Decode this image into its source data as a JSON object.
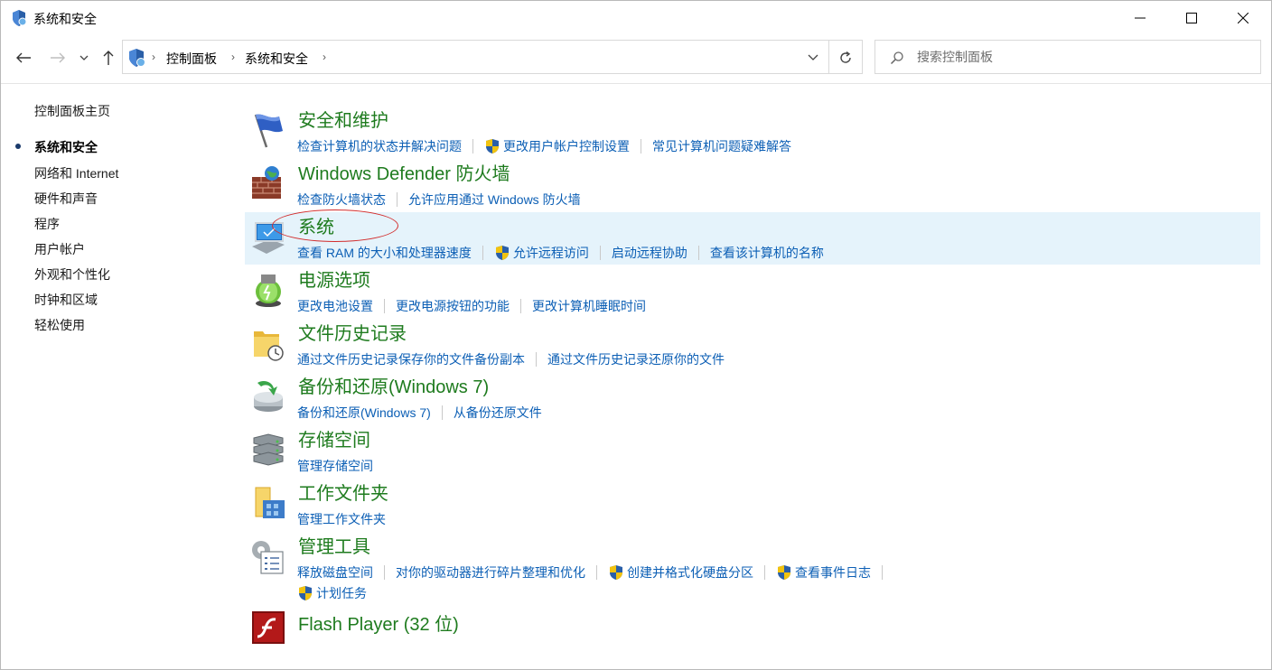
{
  "window": {
    "title": "系统和安全",
    "controls": {
      "minimize": "minimize",
      "maximize": "maximize",
      "close": "close"
    }
  },
  "address": {
    "crumbs": [
      "控制面板",
      "系统和安全"
    ]
  },
  "search": {
    "placeholder": "搜索控制面板",
    "value": ""
  },
  "sidebar": {
    "home": "控制面板主页",
    "items": [
      {
        "label": "系统和安全",
        "active": true
      },
      {
        "label": "网络和 Internet"
      },
      {
        "label": "硬件和声音"
      },
      {
        "label": "程序"
      },
      {
        "label": "用户帐户"
      },
      {
        "label": "外观和个性化"
      },
      {
        "label": "时钟和区域"
      },
      {
        "label": "轻松使用"
      }
    ]
  },
  "categories": [
    {
      "title": "安全和维护",
      "icon": "flag-icon",
      "links": [
        "检查计算机的状态并解决问题",
        "更改用户帐户控制设置",
        "常见计算机问题疑难解答"
      ]
    },
    {
      "title": "Windows Defender 防火墙",
      "icon": "firewall-icon",
      "links": [
        "检查防火墙状态",
        "允许应用通过 Windows 防火墙"
      ]
    },
    {
      "title": "系统",
      "icon": "computer-icon",
      "links": [
        "查看 RAM 的大小和处理器速度",
        "允许远程访问",
        "启动远程协助",
        "查看该计算机的名称"
      ]
    },
    {
      "title": "电源选项",
      "icon": "power-icon",
      "links": [
        "更改电池设置",
        "更改电源按钮的功能",
        "更改计算机睡眠时间"
      ]
    },
    {
      "title": "文件历史记录",
      "icon": "file-history-icon",
      "links": [
        "通过文件历史记录保存你的文件备份副本",
        "通过文件历史记录还原你的文件"
      ]
    },
    {
      "title": "备份和还原(Windows 7)",
      "icon": "backup-icon",
      "links": [
        "备份和还原(Windows 7)",
        "从备份还原文件"
      ]
    },
    {
      "title": "存储空间",
      "icon": "storage-icon",
      "links": [
        "管理存储空间"
      ]
    },
    {
      "title": "工作文件夹",
      "icon": "work-folder-icon",
      "links": [
        "管理工作文件夹"
      ]
    },
    {
      "title": "管理工具",
      "icon": "admin-tools-icon",
      "links": [
        "释放磁盘空间",
        "对你的驱动器进行碎片整理和优化",
        "创建并格式化硬盘分区",
        "查看事件日志",
        "计划任务"
      ]
    },
    {
      "title": "Flash Player (32 位)",
      "icon": "flash-icon",
      "links": []
    }
  ],
  "colors": {
    "category_title": "#1e7b1e",
    "link": "#0c5fb5",
    "highlight_row": "#e5f3fb",
    "annotation_ellipse": "#d22c2c"
  }
}
